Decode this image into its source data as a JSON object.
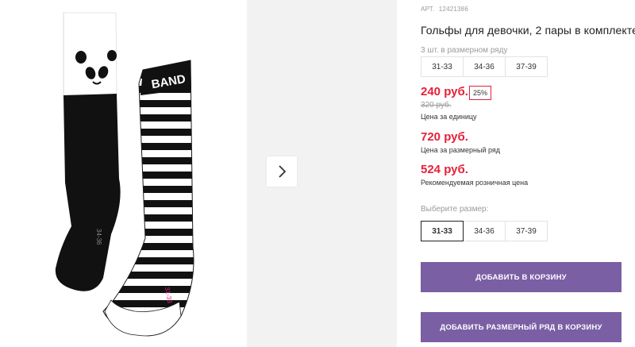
{
  "product": {
    "article_label": "АРТ.",
    "article_number": "12421386",
    "title": "Гольфы для девочки, 2 пары в комплекте",
    "pack_caption": "3 шт. в размерном ряду",
    "pack_sizes": [
      "31-33",
      "34-36",
      "37-39"
    ],
    "sock_sizes": [
      "34-36",
      "31-33"
    ]
  },
  "pricing": {
    "unit_price": "240 руб.",
    "discount": "25%",
    "old_price": "320 руб.",
    "unit_caption": "Цена за единицу",
    "pack_price": "720 руб.",
    "pack_caption": "Цена за размерный ряд",
    "rrp_price": "524 руб.",
    "rrp_caption": "Рекомендуемая розничная цена"
  },
  "size_select": {
    "label": "Выберите размер:",
    "options": [
      "31-33",
      "34-36",
      "37-39"
    ],
    "selected": "31-33"
  },
  "actions": {
    "add_to_cart": "ДОБАВИТЬ В КОРЗИНУ",
    "add_pack_to_cart": "ДОБАВИТЬ РАЗМЕРНЫЙ РЯД В КОРЗИНУ"
  },
  "logo_text": "BAND",
  "colors": {
    "accent": "#7a5fa5",
    "price": "#e5213a",
    "muted": "#9a9a9a"
  },
  "icons": {
    "next": "chevron-right-icon"
  }
}
